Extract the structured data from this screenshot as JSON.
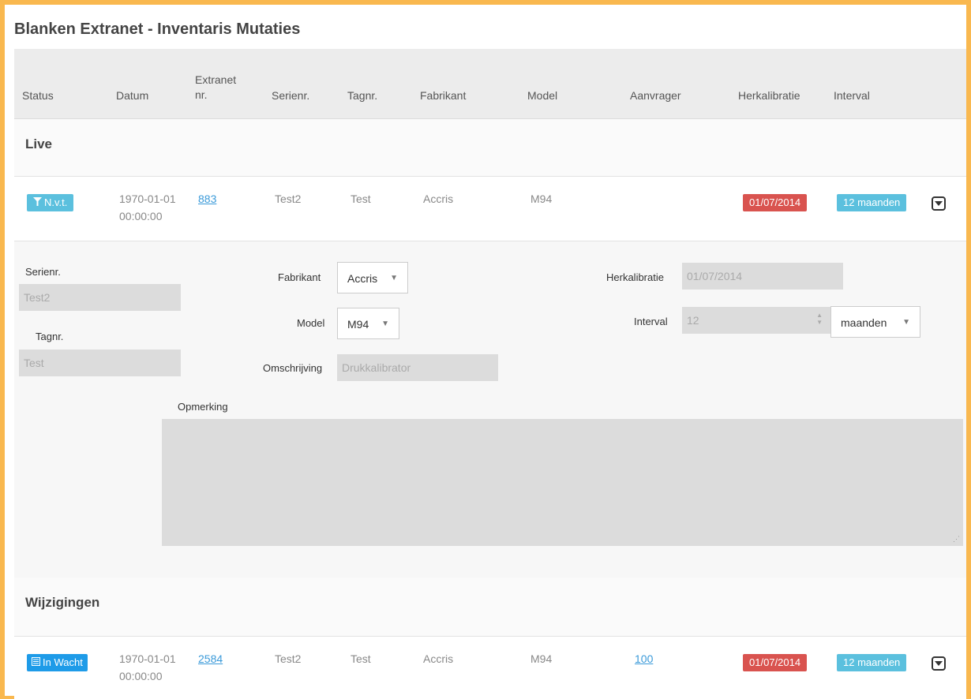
{
  "title": "Blanken Extranet - Inventaris Mutaties",
  "columns": {
    "status": "Status",
    "datum": "Datum",
    "extranet_line1": "Extranet",
    "extranet_line2": "nr.",
    "serienr": "Serienr.",
    "tagnr": "Tagnr.",
    "fabrikant": "Fabrikant",
    "model": "Model",
    "aanvrager": "Aanvrager",
    "herkalibratie": "Herkalibratie",
    "interval": "Interval"
  },
  "sections": {
    "live": "Live",
    "wijzigingen": "Wijzigingen"
  },
  "live_row": {
    "status": "N.v.t.",
    "status_icon": "filter-icon",
    "date_line1": "1970-01-01",
    "date_line2": "00:00:00",
    "extranet_nr": "883",
    "serienr": "Test2",
    "tagnr": "Test",
    "fabrikant": "Accris",
    "model": "M94",
    "aanvrager": "",
    "herkalibratie": "01/07/2014",
    "interval": "12 maanden"
  },
  "detail": {
    "serienr_label": "Serienr.",
    "serienr_value": "Test2",
    "tagnr_label": "Tagnr.",
    "tagnr_value": "Test",
    "fabrikant_label": "Fabrikant",
    "fabrikant_value": "Accris",
    "model_label": "Model",
    "model_value": "M94",
    "omschrijving_label": "Omschrijving",
    "omschrijving_placeholder": "Drukkalibrator",
    "herkalibratie_label": "Herkalibratie",
    "herkalibratie_value": "01/07/2014",
    "interval_label": "Interval",
    "interval_value": "12",
    "interval_unit": "maanden",
    "opmerking_label": "Opmerking"
  },
  "wijziging_row": {
    "status": "In Wacht",
    "status_icon": "list-icon",
    "date_line1": "1970-01-01",
    "date_line2": "00:00:00",
    "extranet_nr": "2584",
    "serienr": "Test2",
    "tagnr": "Test",
    "fabrikant": "Accris",
    "model": "M94",
    "aanvrager": "100",
    "herkalibratie": "01/07/2014",
    "interval": "12 maanden"
  },
  "colors": {
    "frame": "#f9b84f",
    "badge_info": "#5bc0de",
    "badge_primary": "#1e9be8",
    "badge_danger": "#d9534f",
    "link": "#3a9ad9"
  }
}
